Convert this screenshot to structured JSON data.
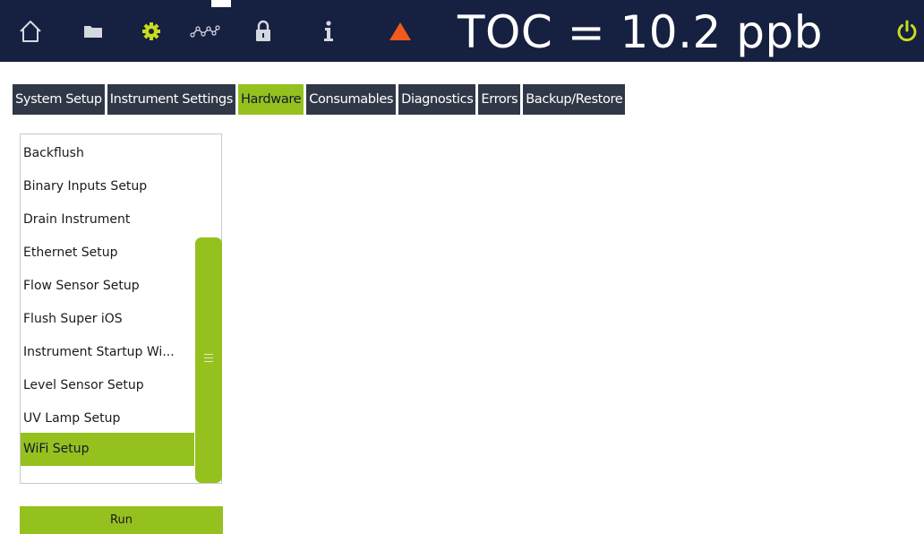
{
  "toolbar": {
    "icons": [
      "home-icon",
      "folder-icon",
      "gear-icon",
      "trend-icon",
      "lock-icon",
      "info-icon",
      "alarm-icon",
      "power-icon"
    ],
    "toc_reading": "TOC = 10.2 ppb",
    "colors": {
      "background": "#162040",
      "gear": "#c8dc1e",
      "alarm": "#ef5a1e",
      "power": "#c8dc1e",
      "icon": "#d6d8e0"
    }
  },
  "tabs": [
    "System Setup",
    "Instrument Settings",
    "Hardware",
    "Consumables",
    "Diagnostics",
    "Errors",
    "Backup/Restore"
  ],
  "active_tab": "Hardware",
  "list": {
    "items": [
      "Backflush",
      "Binary Inputs Setup",
      "Drain Instrument",
      "Ethernet Setup",
      "Flow Sensor Setup",
      "Flush Super iOS",
      "Instrument Startup Wi...",
      "Level Sensor Setup",
      "UV Lamp Setup",
      "WiFi Setup"
    ],
    "selected": "WiFi Setup"
  },
  "run_button": "Run",
  "colors": {
    "accent": "#95c11f",
    "tab_bg": "#303848",
    "tab_text": "#ffffff"
  }
}
